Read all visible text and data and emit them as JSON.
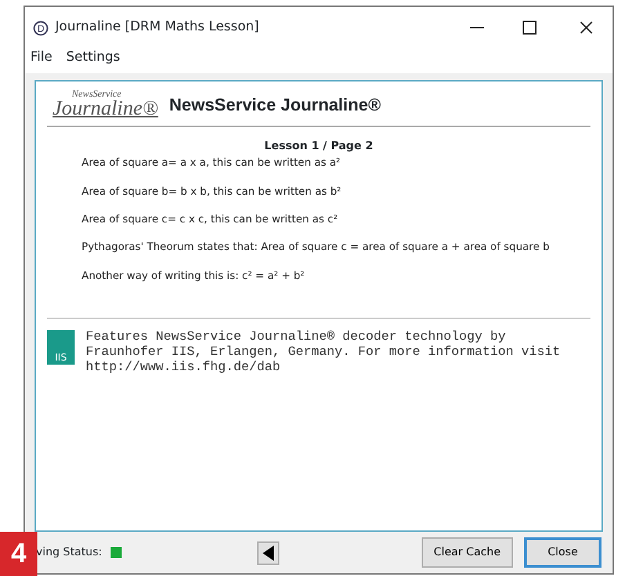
{
  "window": {
    "icon_letter": "D",
    "title": "Journaline [DRM Maths Lesson]"
  },
  "menu": [
    "File",
    "Settings"
  ],
  "header": {
    "logo_top": "NewsService",
    "logo_main": "Journaline®",
    "title": "NewsService Journaline®"
  },
  "lesson": {
    "heading": "Lesson 1 / Page 2",
    "lines": [
      "Area of square a= a x a, this can be written as a²",
      "Area of square b= b x b, this can be written as b²",
      "Area of square c= c x c, this can be written as c²",
      "Pythagoras' Theorum states that: Area of square c = area of square a + area of square b",
      "Another way of writing this is: c² = a² + b²"
    ]
  },
  "footer": {
    "logo_text": "IIS",
    "text": "Features NewsService Journaline® decoder technology by Fraunhofer IIS, Erlangen, Germany. For more information visit http://www.iis.fhg.de/dab"
  },
  "status": {
    "label": "ving Status:",
    "ok": true
  },
  "buttons": [
    {
      "label": "Clear Cache",
      "default": false
    },
    {
      "label": "Close",
      "default": true
    }
  ],
  "figure_number": "4"
}
